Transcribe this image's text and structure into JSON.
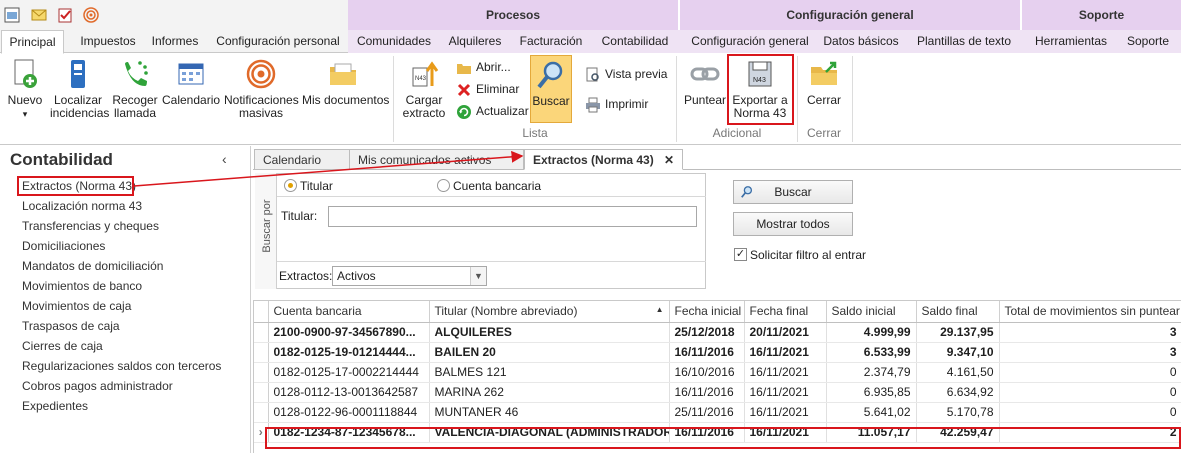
{
  "ribbon": {
    "contexts": [
      "Procesos",
      "Configuración general",
      "Soporte"
    ],
    "tabs": [
      "Principal",
      "Impuestos",
      "Informes",
      "Configuración personal",
      "Comunidades",
      "Alquileres",
      "Facturación",
      "Contabilidad",
      "Configuración general",
      "Datos básicos",
      "Plantillas de texto",
      "Herramientas",
      "Soporte"
    ],
    "buttons": {
      "nuevo": "Nuevo",
      "localizar_1": "Localizar",
      "localizar_2": "incidencias",
      "recoger_1": "Recoger",
      "recoger_2": "llamada",
      "calendario": "Calendario",
      "notif_1": "Notificaciones",
      "notif_2": "masivas",
      "misdocs": "Mis documentos",
      "cargar_1": "Cargar",
      "cargar_2": "extracto",
      "abrir": "Abrir...",
      "eliminar": "Eliminar",
      "actualizar": "Actualizar",
      "buscar": "Buscar",
      "vista_previa": "Vista previa",
      "imprimir": "Imprimir",
      "puntear": "Puntear",
      "exportar_1": "Exportar a",
      "exportar_2": "Norma 43",
      "cerrar": "Cerrar"
    },
    "groups": {
      "lista": "Lista",
      "adicional": "Adicional",
      "cerrar": "Cerrar"
    }
  },
  "left_pane": {
    "title": "Contabilidad",
    "collapse": "‹",
    "items": [
      "Extractos (Norma 43)",
      "Localización norma 43",
      "Transferencias y cheques",
      "Domiciliaciones",
      "Mandatos de domiciliación",
      "Movimientos de banco",
      "Movimientos de caja",
      "Traspasos de caja",
      "Cierres de caja",
      "Regularizaciones saldos con terceros",
      "Cobros pagos administrador",
      "Expedientes"
    ]
  },
  "doc_tabs": [
    "Calendario",
    "Mis comunicados activos",
    "Extractos (Norma 43)"
  ],
  "filter": {
    "vertical_label": "Buscar por",
    "radio_titular": "Titular",
    "radio_cuenta": "Cuenta bancaria",
    "titular_label": "Titular:",
    "titular_value": "",
    "extractos_label": "Extractos:",
    "extractos_value": "Activos",
    "buscar": "Buscar",
    "mostrar_todos": "Mostrar todos",
    "solicitar": "Solicitar filtro al entrar",
    "solicitar_checked": true
  },
  "grid": {
    "columns": [
      "Cuenta bancaria",
      "Titular (Nombre abreviado)",
      "Fecha inicial",
      "Fecha final",
      "Saldo inicial",
      "Saldo final",
      "Total de movimientos sin puntear"
    ],
    "sort_indicator": "▲",
    "row_indicator": "›",
    "rows": [
      {
        "bold": true,
        "cells": [
          "2100-0900-97-34567890...",
          "ALQUILERES",
          "25/12/2018",
          "20/11/2021",
          "4.999,99",
          "29.137,95",
          "3"
        ]
      },
      {
        "bold": true,
        "cells": [
          "0182-0125-19-01214444...",
          "BAILEN 20",
          "16/11/2016",
          "16/11/2021",
          "6.533,99",
          "9.347,10",
          "3"
        ]
      },
      {
        "bold": false,
        "cells": [
          "0182-0125-17-0002214444",
          "BALMES 121",
          "16/10/2016",
          "16/11/2021",
          "2.374,79",
          "4.161,50",
          "0"
        ]
      },
      {
        "bold": false,
        "cells": [
          "0128-0112-13-0013642587",
          "MARINA 262",
          "16/11/2016",
          "16/11/2021",
          "6.935,85",
          "6.634,92",
          "0"
        ]
      },
      {
        "bold": false,
        "cells": [
          "0128-0122-96-0001118844",
          "MUNTANER 46",
          "25/11/2016",
          "16/11/2021",
          "5.641,02",
          "5.170,78",
          "0"
        ]
      },
      {
        "bold": true,
        "selected": true,
        "cells": [
          "0182-1234-87-12345678...",
          "VALENCIA-DIAGONAL (ADMINISTRADOR)",
          "16/11/2016",
          "16/11/2021",
          "11.057,17",
          "42.259,47",
          "2"
        ]
      }
    ]
  },
  "colors": {
    "annotation_red": "#d9161c",
    "context_purple": "#e2c9ec",
    "active_button": "#fbd67a"
  }
}
